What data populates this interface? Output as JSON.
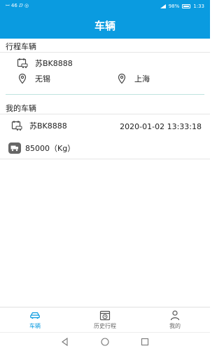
{
  "status_bar": {
    "left_text": "ꟷ 46 ⅅ ◎",
    "battery": "98%",
    "time": "1:33"
  },
  "header": {
    "title": "车辆"
  },
  "trip_vehicle": {
    "section_title": "行程车辆",
    "plate": "苏BK8888",
    "origin": "无锡",
    "destination": "上海"
  },
  "my_vehicle": {
    "section_title": "我的车辆",
    "plate": "苏BK8888",
    "datetime": "2020-01-02 13:33:18",
    "weight": "85000（Kg）"
  },
  "bottom_nav": {
    "items": [
      {
        "label": "车辆",
        "icon": "car-icon",
        "active": true
      },
      {
        "label": "历史行程",
        "icon": "calendar-clock-icon",
        "active": false
      },
      {
        "label": "我的",
        "icon": "user-icon",
        "active": false
      }
    ]
  },
  "colors": {
    "primary": "#0a9be0",
    "divider": "#bfe3df",
    "text": "#222222"
  }
}
